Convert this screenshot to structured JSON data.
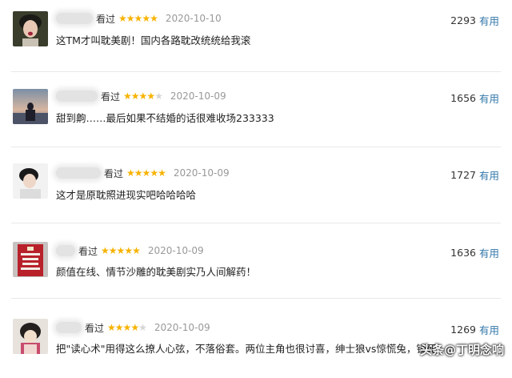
{
  "comments": [
    {
      "status": "看过",
      "rating": 5,
      "date": "2020-10-10",
      "text": "这TM才叫耽美剧！国内各路耽改统统给我滚",
      "votes": "2293",
      "useful_label": "有用"
    },
    {
      "status": "看过",
      "rating": 4,
      "date": "2020-10-09",
      "text": "甜到齁……最后如果不结婚的话很难收场233333",
      "votes": "1656",
      "useful_label": "有用"
    },
    {
      "status": "看过",
      "rating": 5,
      "date": "2020-10-09",
      "text": "这才是原耽照进现实吧哈哈哈哈",
      "votes": "1727",
      "useful_label": "有用"
    },
    {
      "status": "看过",
      "rating": 5,
      "date": "2020-10-09",
      "text": "颜值在线、情节沙雕的耽美剧实乃人间解药！",
      "votes": "1636",
      "useful_label": "有用"
    },
    {
      "status": "看过",
      "rating": 4,
      "date": "2020-10-09",
      "text": "把\"读心术\"用得这么撩人心弦，不落俗套。两位主角也很讨喜，绅士狼vs惊慌兔，锁死",
      "votes": "1269",
      "useful_label": "有用"
    }
  ],
  "watermark": "头条@丁明念响",
  "colors": {
    "star_on": "#f7b300",
    "star_off": "#d6d6d6",
    "useful_link": "#3377aa",
    "date": "#999999"
  }
}
